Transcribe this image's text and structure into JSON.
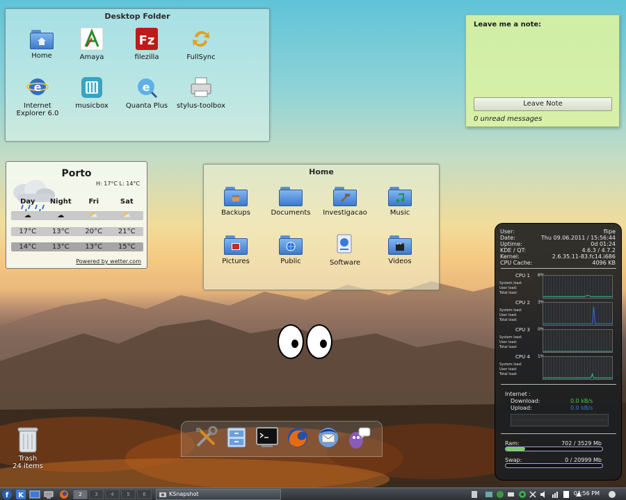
{
  "desktop_folder": {
    "title": "Desktop Folder",
    "items": [
      {
        "label": "Home",
        "icon": "home-folder-icon"
      },
      {
        "label": "Amaya",
        "icon": "amaya-icon"
      },
      {
        "label": "filezilla",
        "icon": "filezilla-icon"
      },
      {
        "label": "FullSync",
        "icon": "fullsync-icon"
      },
      {
        "label": "Internet Explorer 6.0",
        "icon": "internet-explorer-icon"
      },
      {
        "label": "musicbox",
        "icon": "musicbox-icon"
      },
      {
        "label": "Quanta Plus",
        "icon": "quanta-plus-icon"
      },
      {
        "label": "stylus-toolbox",
        "icon": "printer-icon"
      }
    ]
  },
  "note": {
    "title": "Leave me a note:",
    "button": "Leave Note",
    "status": "0 unread messages"
  },
  "weather": {
    "city": "Porto",
    "high_low": "H: 17°C L: 14°C",
    "days": [
      "Day",
      "Night",
      "Fri",
      "Sat"
    ],
    "highs": [
      "17°C",
      "13°C",
      "20°C",
      "21°C"
    ],
    "lows": [
      "14°C",
      "13°C",
      "13°C",
      "15°C"
    ],
    "powered_by": "Powered by wetter.com"
  },
  "home_folder": {
    "title": "Home",
    "items": [
      {
        "label": "Backups",
        "icon": "backups-folder-icon"
      },
      {
        "label": "Documents",
        "icon": "documents-folder-icon"
      },
      {
        "label": "Investigacao",
        "icon": "tools-folder-icon"
      },
      {
        "label": "Music",
        "icon": "music-folder-icon"
      },
      {
        "label": "Pictures",
        "icon": "pictures-folder-icon"
      },
      {
        "label": "Public",
        "icon": "public-folder-icon"
      },
      {
        "label": "Software",
        "icon": "software-icon"
      },
      {
        "label": "Videos",
        "icon": "videos-folder-icon"
      }
    ]
  },
  "sysmon": {
    "info": [
      {
        "k": "User:",
        "v": "flipe"
      },
      {
        "k": "Date:",
        "v": "Thu 09.06.2011 / 15:56:44"
      },
      {
        "k": "Uptime:",
        "v": "0d 01:24"
      },
      {
        "k": "KDE / QT:",
        "v": "4.6.3 / 4.7.2"
      },
      {
        "k": "Kernel:",
        "v": "2.6.35.11-83.fc14.i686"
      },
      {
        "k": "CPU Cache:",
        "v": "4096 KB"
      }
    ],
    "cpus": [
      {
        "name": "CPU 1",
        "pct": "6%"
      },
      {
        "name": "CPU 2",
        "pct": "3%"
      },
      {
        "name": "CPU 3",
        "pct": "0%"
      },
      {
        "name": "CPU 4",
        "pct": "1%"
      }
    ],
    "cpu_sub_labels": [
      "System load:",
      "User load:",
      "Total load:"
    ],
    "internet": {
      "title": "Internet :",
      "download_label": "Download:",
      "download_value": "0.0 kB/s",
      "upload_label": "Upload:",
      "upload_value": "0.0 kB/s"
    },
    "ram": {
      "label": "Ram:",
      "value": "702 / 3529 Mb",
      "fraction": 0.2
    },
    "swap": {
      "label": "Swap:",
      "value": "0 / 20999 Mb",
      "fraction": 0.0
    }
  },
  "dock": {
    "items": [
      {
        "icon": "system-settings-icon"
      },
      {
        "icon": "file-manager-icon"
      },
      {
        "icon": "terminal-icon"
      },
      {
        "icon": "firefox-icon"
      },
      {
        "icon": "thunderbird-icon"
      },
      {
        "icon": "pidgin-icon"
      }
    ]
  },
  "trash": {
    "label": "Trash",
    "count": "24 items"
  },
  "taskbar": {
    "pager": [
      "2",
      "3",
      "4",
      "5",
      "6"
    ],
    "task_label": "KSnapshot",
    "clock": "03:56 PM"
  }
}
